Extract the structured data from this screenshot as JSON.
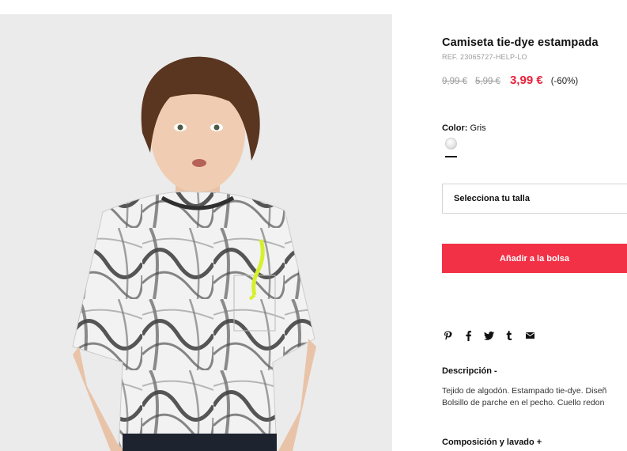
{
  "product": {
    "image_alt": "Niño con camiseta tie-dye gris",
    "title": "Camiseta tie-dye estampada",
    "ref": "REF. 23065727-HELP-LO",
    "price_original": "9,99 €",
    "price_previous": "5,99 €",
    "price_current": "3,99 €",
    "discount": "(-60%)"
  },
  "color": {
    "label": "Color:",
    "value": "Gris",
    "swatch_icon": "grey-swatch-icon",
    "swatch_color": "#e0e0e0"
  },
  "size_select": {
    "placeholder": "Selecciona tu talla"
  },
  "add_button": {
    "label": "Añadir a la bolsa",
    "color": "#f23147"
  },
  "share_icons": [
    "pinterest-icon",
    "facebook-icon",
    "twitter-icon",
    "tumblr-icon",
    "email-icon"
  ],
  "description": {
    "title": "Descripción -",
    "line1": "Tejido de algodón. Estampado tie-dye. Diseñ",
    "line2": "Bolsillo de parche en el pecho. Cuello redon"
  },
  "composition": {
    "title": "Composición y lavado +"
  },
  "colors": {
    "accent_red": "#e8203a",
    "muted_text": "#9a9a9a"
  }
}
